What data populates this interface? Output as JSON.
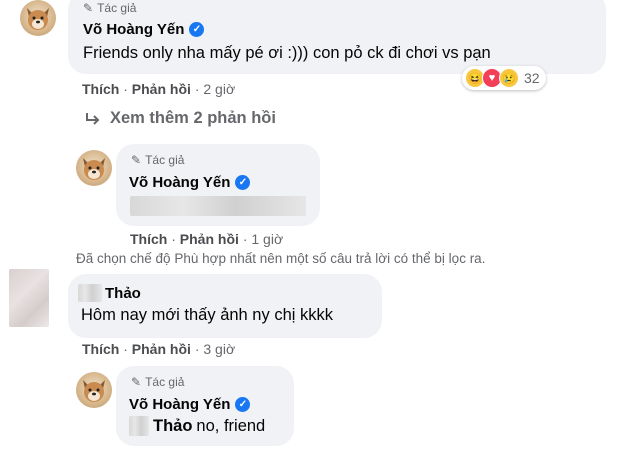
{
  "comments": [
    {
      "author_badge": "Tác giả",
      "author_name": "Võ Hoàng Yến",
      "text": "Friends only nha mấy pé ơi :))) con pỏ ck đi chơi vs pạn",
      "reaction_count": "32",
      "like_label": "Thích",
      "reply_label": "Phản hồi",
      "time": "2 giờ"
    }
  ],
  "view_more": "Xem thêm 2 phản hồi",
  "reply1": {
    "author_badge": "Tác giả",
    "author_name": "Võ Hoàng Yến",
    "like_label": "Thích",
    "reply_label": "Phản hồi",
    "time": "1 giờ"
  },
  "filter_notice": "Đã chọn chế độ Phù hợp nhất nên một số câu trả lời có thể bị lọc ra.",
  "comment2": {
    "author_name": "Thảo",
    "text": "Hôm nay mới thấy ảnh ny chị kkkk",
    "like_label": "Thích",
    "reply_label": "Phản hồi",
    "time": "3 giờ"
  },
  "reply2": {
    "author_badge": "Tác giả",
    "author_name": "Võ Hoàng Yến",
    "mention": "Thảo",
    "text": "no, friend"
  },
  "colors": {
    "verified": "#1877f2",
    "bubble": "#f0f2f5",
    "meta": "#65676b"
  }
}
